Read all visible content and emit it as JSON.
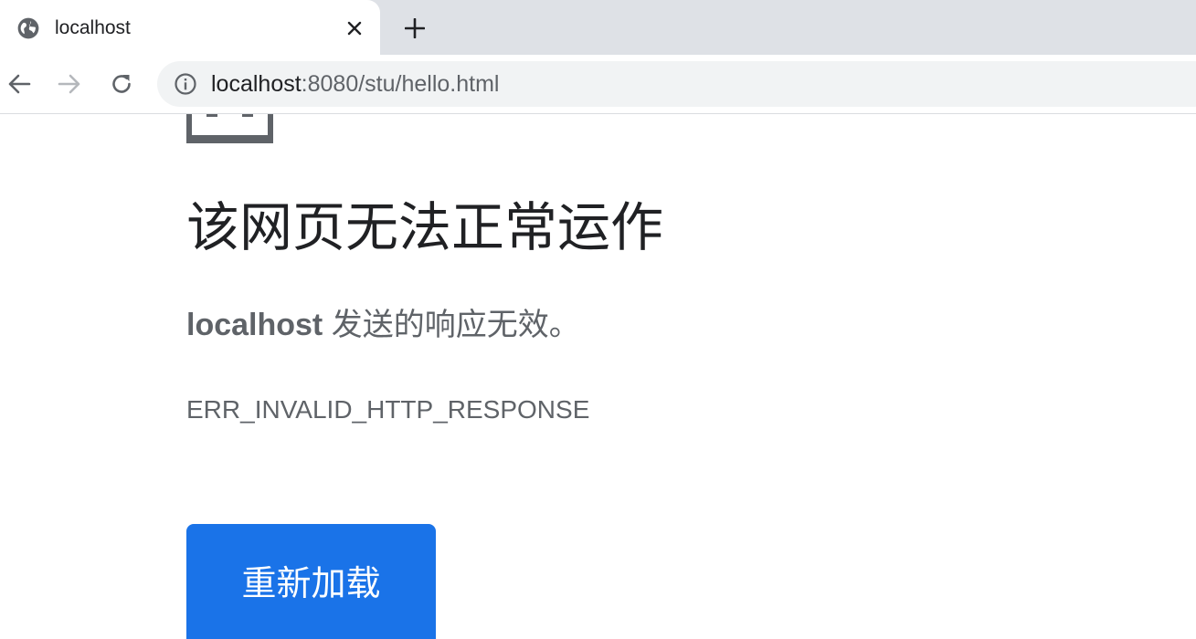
{
  "browser": {
    "tab": {
      "title": "localhost",
      "favicon": "globe-icon",
      "close_icon": "close-icon"
    },
    "new_tab_icon": "plus-icon",
    "nav": {
      "back_icon": "arrow-left-icon",
      "forward_icon": "arrow-right-icon",
      "reload_icon": "reload-icon"
    },
    "address_bar": {
      "info_icon": "info-icon",
      "url_host": "localhost",
      "url_rest": ":8080/stu/hello.html"
    }
  },
  "page": {
    "icon": "sad-page-icon",
    "headline": "该网页无法正常运作",
    "summary_host": "localhost",
    "summary_text": " 发送的响应无效。",
    "error_code": "ERR_INVALID_HTTP_RESPONSE",
    "reload_button_label": "重新加载"
  },
  "colors": {
    "accent": "#1a73e8",
    "tabstrip": "#dee1e6",
    "omnibox": "#f1f3f4",
    "text_secondary": "#5f6368"
  }
}
